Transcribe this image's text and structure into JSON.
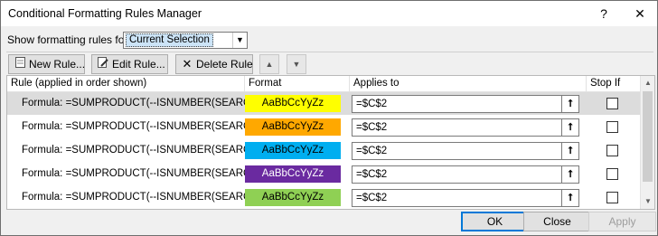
{
  "window": {
    "title": "Conditional Formatting Rules Manager",
    "help": "?",
    "close": "✕"
  },
  "show_rules": {
    "label": "Show formatting rules for:",
    "selected": "Current Selection"
  },
  "toolbar": {
    "new_rule": "New Rule...",
    "edit_rule": "Edit Rule...",
    "delete_rule": "Delete Rule"
  },
  "columns": {
    "rule": "Rule (applied in order shown)",
    "format": "Format",
    "applies_to": "Applies to",
    "stop_if_true": "Stop If True"
  },
  "rules": [
    {
      "rule": "Formula: =SUMPRODUCT(--ISNUMBER(SEARCH(\"...",
      "format_preview": "AaBbCcYyZz",
      "format_color": "#ffff00",
      "format_text_color": "#000000",
      "applies_to": "=$C$2",
      "stop_if_true": false
    },
    {
      "rule": "Formula: =SUMPRODUCT(--ISNUMBER(SEARCH(\"F...",
      "format_preview": "AaBbCcYyZz",
      "format_color": "#ffa800",
      "format_text_color": "#000000",
      "applies_to": "=$C$2",
      "stop_if_true": false
    },
    {
      "rule": "Formula: =SUMPRODUCT(--ISNUMBER(SEARCH(\"...",
      "format_preview": "AaBbCcYyZz",
      "format_color": "#00aef0",
      "format_text_color": "#000000",
      "applies_to": "=$C$2",
      "stop_if_true": false
    },
    {
      "rule": "Formula: =SUMPRODUCT(--ISNUMBER(SEARCH(\"...",
      "format_preview": "AaBbCcYyZz",
      "format_color": "#6a2aa0",
      "format_text_color": "#ffffff",
      "applies_to": "=$C$2",
      "stop_if_true": false
    },
    {
      "rule": "Formula: =SUMPRODUCT(--ISNUMBER(SEARCH(\"T...",
      "format_preview": "AaBbCcYyZz",
      "format_color": "#8fd054",
      "format_text_color": "#000000",
      "applies_to": "=$C$2",
      "stop_if_true": false
    }
  ],
  "buttons": {
    "ok": "OK",
    "close": "Close",
    "apply": "Apply"
  }
}
